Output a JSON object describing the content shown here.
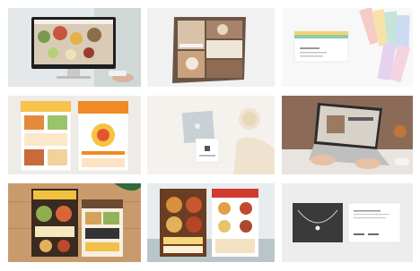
{
  "gallery": {
    "items": [
      {
        "id": "desktop-mockup",
        "kind": "website-on-monitor"
      },
      {
        "id": "restaurant-poster",
        "kind": "poster-mockup"
      },
      {
        "id": "business-card-palette",
        "kind": "business-card"
      },
      {
        "id": "food-flyers",
        "kind": "flyer-pair"
      },
      {
        "id": "square-cards",
        "kind": "square-card-pair"
      },
      {
        "id": "laptop-typing",
        "kind": "laptop-photo"
      },
      {
        "id": "menu-flyers-wood",
        "kind": "flyer-pair"
      },
      {
        "id": "pizza-flyers",
        "kind": "flyer-pair"
      },
      {
        "id": "necklace-card",
        "kind": "product-card"
      }
    ]
  },
  "colors": {
    "accent_orange": "#f08a24",
    "accent_yellow": "#f6c343",
    "dark_wood": "#6b4a33"
  }
}
